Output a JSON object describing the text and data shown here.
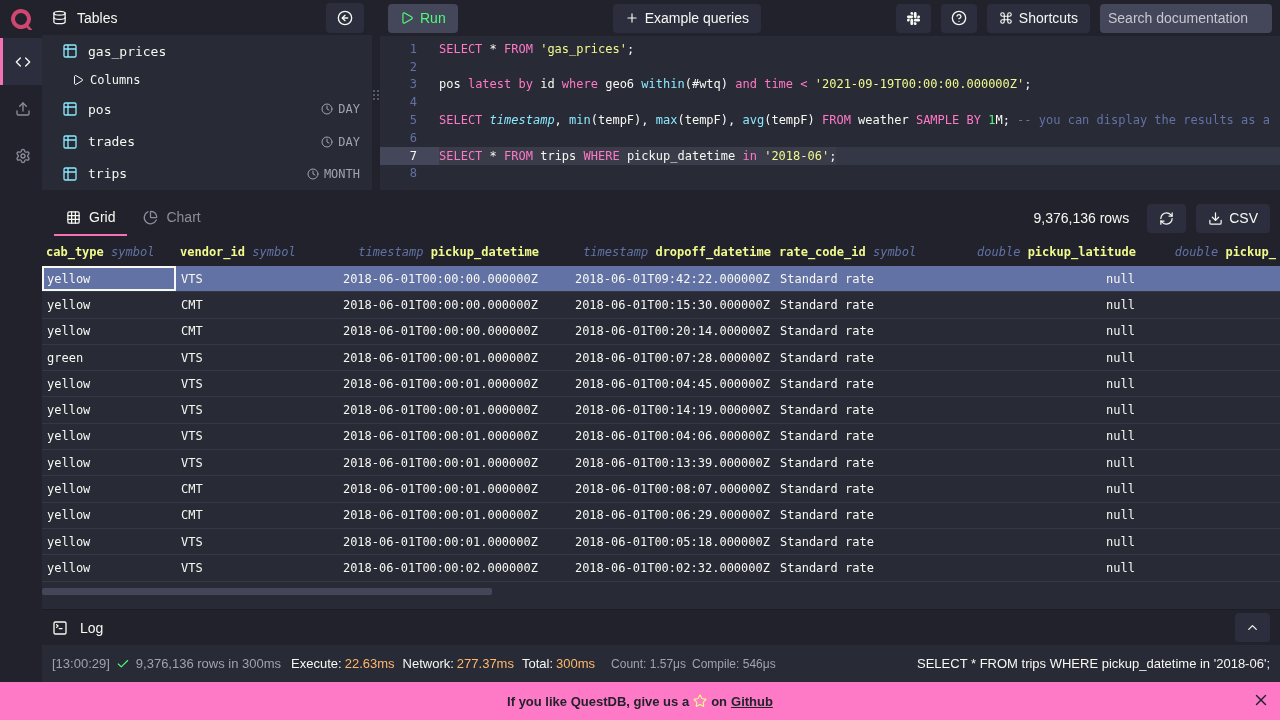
{
  "nav": {
    "items": [
      {
        "kind": "editor",
        "selected": true
      },
      {
        "kind": "import",
        "selected": false
      },
      {
        "kind": "settings",
        "selected": false
      }
    ]
  },
  "sidebar": {
    "title": "Tables",
    "tables": [
      {
        "name": "gas_prices",
        "children": [
          {
            "name": "Columns",
            "expanded": false
          }
        ]
      },
      {
        "name": "pos",
        "partition": "DAY"
      },
      {
        "name": "trades",
        "partition": "DAY"
      },
      {
        "name": "trips",
        "partition": "MONTH"
      }
    ]
  },
  "toolbar": {
    "run": "Run",
    "examples": "Example queries",
    "shortcuts": "Shortcuts",
    "search": {
      "placeholder": "Search documentation"
    }
  },
  "editor": {
    "lines": [
      {
        "number": "1",
        "selected": false,
        "tokens": [
          {
            "kind": "kw",
            "text": "SELECT"
          },
          {
            "kind": "plain",
            "text": " * "
          },
          {
            "kind": "kw",
            "text": "FROM "
          },
          {
            "kind": "str",
            "text": "'gas_prices'"
          },
          {
            "kind": "plain",
            "text": ";"
          }
        ]
      },
      {
        "number": "2",
        "selected": false
      },
      {
        "number": "3",
        "selected": false,
        "tokens": [
          {
            "kind": "plain",
            "text": "pos "
          },
          {
            "kind": "kw",
            "text": "latest by"
          },
          {
            "kind": "plain",
            "text": " id "
          },
          {
            "kind": "kw",
            "text": "where"
          },
          {
            "kind": "plain",
            "text": " geo6 "
          },
          {
            "kind": "fn",
            "text": "within"
          },
          {
            "kind": "plain",
            "text": "(#wtq) "
          },
          {
            "kind": "kw",
            "text": "and time < "
          },
          {
            "kind": "str",
            "text": "'2021-09-19T00:00:00.000000Z'"
          },
          {
            "kind": "plain",
            "text": ";"
          }
        ]
      },
      {
        "number": "4",
        "selected": false
      },
      {
        "number": "5",
        "selected": false,
        "tokens": [
          {
            "kind": "kw",
            "text": "SELECT "
          },
          {
            "kind": "it",
            "text": "timestamp"
          },
          {
            "kind": "plain",
            "text": ", "
          },
          {
            "kind": "fn",
            "text": "min"
          },
          {
            "kind": "plain",
            "text": "(tempF), "
          },
          {
            "kind": "fn",
            "text": "max"
          },
          {
            "kind": "plain",
            "text": "(tempF), "
          },
          {
            "kind": "fn",
            "text": "avg"
          },
          {
            "kind": "plain",
            "text": "(tempF) "
          },
          {
            "kind": "kw",
            "text": "FROM"
          },
          {
            "kind": "plain",
            "text": " weather "
          },
          {
            "kind": "kw",
            "text": "SAMPLE BY "
          },
          {
            "kind": "num",
            "text": "1"
          },
          {
            "kind": "plain",
            "text": "M; "
          },
          {
            "kind": "comment",
            "text": "-- you can display the results as a"
          }
        ]
      },
      {
        "number": "6",
        "selected": false
      },
      {
        "number": "7",
        "selected": true,
        "tokens": [
          {
            "kind": "kw",
            "text": "SELECT"
          },
          {
            "kind": "plain",
            "text": " * "
          },
          {
            "kind": "kw",
            "text": "FROM"
          },
          {
            "kind": "plain",
            "text": " trips "
          },
          {
            "kind": "kw",
            "text": "WHERE"
          },
          {
            "kind": "plain",
            "text": " pickup_datetime "
          },
          {
            "kind": "kw",
            "text": "in "
          },
          {
            "kind": "str",
            "text": "'2018-06'"
          },
          {
            "kind": "plain",
            "text": ";"
          }
        ]
      },
      {
        "number": "8",
        "selected": false
      }
    ]
  },
  "results": {
    "tabs": [
      {
        "kind": "grid",
        "label": "Grid",
        "selected": true
      },
      {
        "kind": "chart",
        "label": "Chart",
        "selected": false
      }
    ],
    "row_count": "9,376,136 rows",
    "export": "CSV",
    "columns": [
      {
        "type": "symbol",
        "name": "cab_type",
        "kind": "text"
      },
      {
        "type": "symbol",
        "name": "vendor_id",
        "kind": "text"
      },
      {
        "type": "timestamp",
        "name": "pickup_datetime",
        "kind": "numeric"
      },
      {
        "type": "timestamp",
        "name": "dropoff_datetime",
        "kind": "numeric"
      },
      {
        "type": "symbol",
        "name": "rate_code_id",
        "kind": "text"
      },
      {
        "type": "double",
        "name": "pickup_latitude",
        "kind": "numeric"
      },
      {
        "type": "double",
        "name": "pickup_",
        "kind": "numeric"
      }
    ],
    "rows": [
      {
        "selected": true,
        "focused": true,
        "cells": [
          "yellow",
          "VTS",
          "2018-06-01T00:00:00.000000Z",
          "2018-06-01T09:42:22.000000Z",
          "Standard rate",
          "null"
        ]
      },
      {
        "selected": false,
        "focused": false,
        "cells": [
          "yellow",
          "CMT",
          "2018-06-01T00:00:00.000000Z",
          "2018-06-01T00:15:30.000000Z",
          "Standard rate",
          "null"
        ]
      },
      {
        "selected": false,
        "focused": false,
        "cells": [
          "yellow",
          "CMT",
          "2018-06-01T00:00:00.000000Z",
          "2018-06-01T00:20:14.000000Z",
          "Standard rate",
          "null"
        ]
      },
      {
        "selected": false,
        "focused": false,
        "cells": [
          "green",
          "VTS",
          "2018-06-01T00:00:01.000000Z",
          "2018-06-01T00:07:28.000000Z",
          "Standard rate",
          "null"
        ]
      },
      {
        "selected": false,
        "focused": false,
        "cells": [
          "yellow",
          "VTS",
          "2018-06-01T00:00:01.000000Z",
          "2018-06-01T00:04:45.000000Z",
          "Standard rate",
          "null"
        ]
      },
      {
        "selected": false,
        "focused": false,
        "cells": [
          "yellow",
          "VTS",
          "2018-06-01T00:00:01.000000Z",
          "2018-06-01T00:14:19.000000Z",
          "Standard rate",
          "null"
        ]
      },
      {
        "selected": false,
        "focused": false,
        "cells": [
          "yellow",
          "VTS",
          "2018-06-01T00:00:01.000000Z",
          "2018-06-01T00:04:06.000000Z",
          "Standard rate",
          "null"
        ]
      },
      {
        "selected": false,
        "focused": false,
        "cells": [
          "yellow",
          "VTS",
          "2018-06-01T00:00:01.000000Z",
          "2018-06-01T00:13:39.000000Z",
          "Standard rate",
          "null"
        ]
      },
      {
        "selected": false,
        "focused": false,
        "cells": [
          "yellow",
          "CMT",
          "2018-06-01T00:00:01.000000Z",
          "2018-06-01T00:08:07.000000Z",
          "Standard rate",
          "null"
        ]
      },
      {
        "selected": false,
        "focused": false,
        "cells": [
          "yellow",
          "CMT",
          "2018-06-01T00:00:01.000000Z",
          "2018-06-01T00:06:29.000000Z",
          "Standard rate",
          "null"
        ]
      },
      {
        "selected": false,
        "focused": false,
        "cells": [
          "yellow",
          "VTS",
          "2018-06-01T00:00:01.000000Z",
          "2018-06-01T00:05:18.000000Z",
          "Standard rate",
          "null"
        ]
      },
      {
        "selected": false,
        "focused": false,
        "cells": [
          "yellow",
          "VTS",
          "2018-06-01T00:00:02.000000Z",
          "2018-06-01T00:02:32.000000Z",
          "Standard rate",
          "null"
        ]
      }
    ]
  },
  "log": {
    "title": "Log",
    "expanded": false,
    "time": "[13:00:29]",
    "success": true,
    "summary": "9,376,136 rows in 300ms",
    "timings": [
      {
        "label": "Execute:",
        "value": "22.63ms"
      },
      {
        "label": "Network:",
        "value": "277.37ms"
      },
      {
        "label": "Total:",
        "value": "300ms"
      }
    ],
    "details": [
      "Count: 1.57μs",
      "Compile: 546μs"
    ],
    "query": "SELECT * FROM trips WHERE pickup_datetime in '2018-06';"
  },
  "banner": {
    "before": "If you like QuestDB, give us a",
    "after": "on",
    "link": "Github"
  }
}
